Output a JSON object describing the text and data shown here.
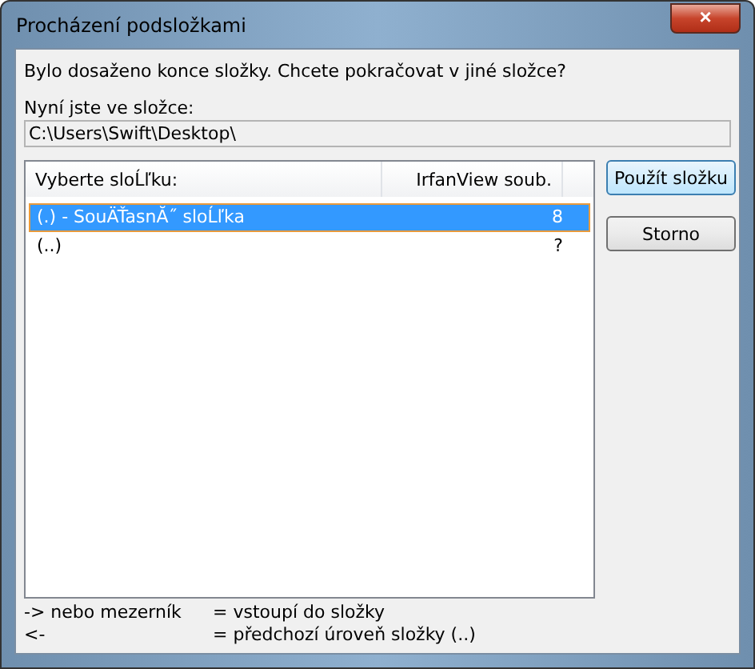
{
  "window": {
    "title": "Procházení podsložkami",
    "close": "×"
  },
  "message": "Bylo dosaženo konce složky. Chcete pokračovat v jiné složce?",
  "current_folder": {
    "label": "Nyní jste ve složce:",
    "value": "C:\\Users\\Swift\\Desktop\\"
  },
  "table": {
    "columns": [
      "Vyberte sloĹľku:",
      "IrfanView soub."
    ],
    "rows": [
      {
        "name": "(.) - SouÄŤasnĂ˝ sloĹľka",
        "count": "8",
        "selected": true
      },
      {
        "name": "(..)",
        "count": "?",
        "selected": false
      }
    ]
  },
  "buttons": [
    {
      "label": "Použít složku",
      "kind": "default"
    },
    {
      "label": "Storno",
      "kind": "normal"
    }
  ],
  "help": [
    {
      "key": "-> nebo mezerník",
      "action": "= vstoupí do složky"
    },
    {
      "key": "<-",
      "action": "= předchozí úroveň složky (..)"
    }
  ]
}
